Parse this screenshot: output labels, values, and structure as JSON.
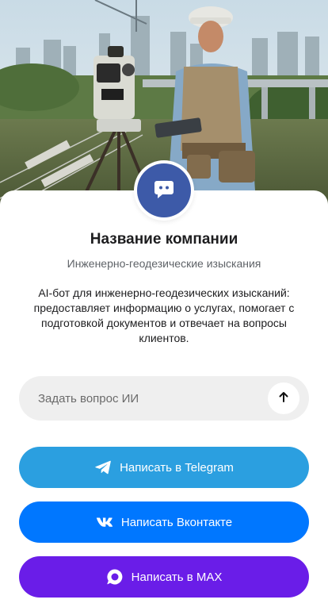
{
  "company": {
    "name": "Название компании",
    "subtitle": "Инженерно-геодезические изыскания",
    "description": "AI-бот для инженерно-геодезических изысканий: предоставляет информацию о услугах, помогает с подготовкой документов и отвечает на вопросы клиентов.",
    "avatar_icon": "chat-bubble-icon"
  },
  "ask": {
    "placeholder": "Задать вопрос ИИ",
    "value": "",
    "send_icon": "arrow-up-icon"
  },
  "buttons": [
    {
      "label": "Написать в Telegram",
      "icon": "telegram-icon",
      "color": "#2b9fe0"
    },
    {
      "label": "Написать Вконтакте",
      "icon": "vk-icon",
      "color": "#0077ff"
    },
    {
      "label": "Написать в MAX",
      "icon": "max-icon",
      "color": "#6a1de8"
    }
  ],
  "colors": {
    "avatar_bg": "#3d5aa8",
    "ask_bg": "#efefef"
  }
}
